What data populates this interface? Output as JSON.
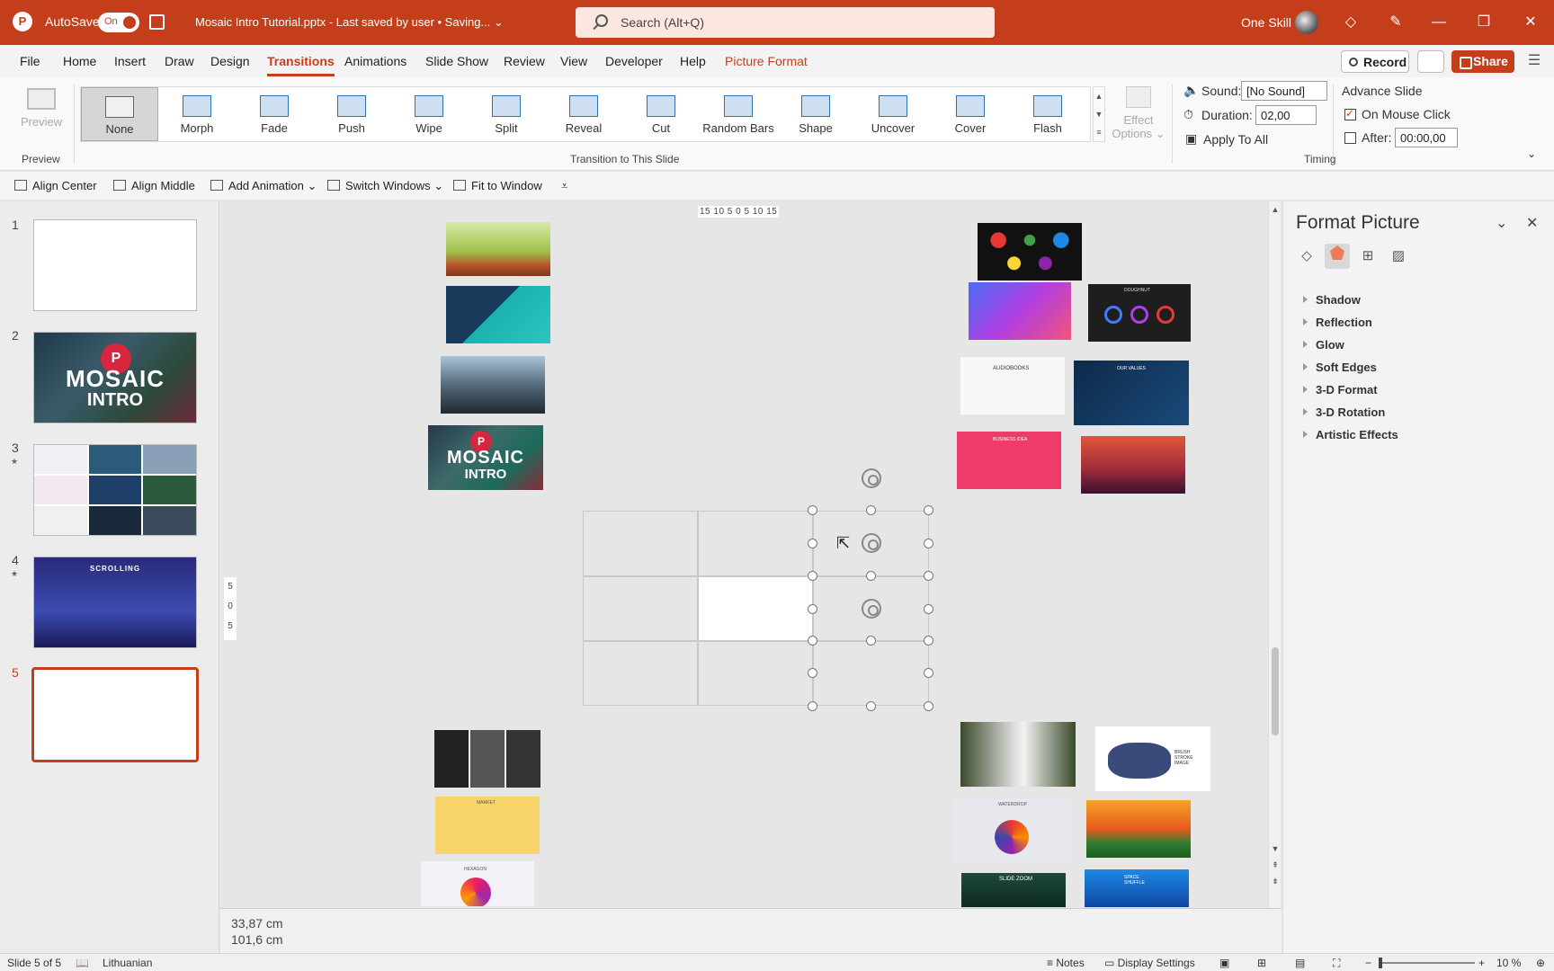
{
  "titlebar": {
    "app_logo": "P",
    "autosave_label": "AutoSave",
    "autosave_state": "On",
    "document_title": "Mosaic Intro Tutorial.pptx  -  Last saved by user • Saving... ⌄",
    "search_placeholder": "Search (Alt+Q)",
    "user_name": "One Skill",
    "accent_color": "#c43e1c"
  },
  "menu": {
    "tabs": [
      "File",
      "Home",
      "Insert",
      "Draw",
      "Design",
      "Transitions",
      "Animations",
      "Slide Show",
      "Review",
      "View",
      "Developer",
      "Help",
      "Picture Format"
    ],
    "active_tab": "Transitions",
    "record_label": "Record",
    "share_label": "Share"
  },
  "ribbon": {
    "preview_label": "Preview",
    "preview_group": "Preview",
    "transitions": [
      "None",
      "Morph",
      "Fade",
      "Push",
      "Wipe",
      "Split",
      "Reveal",
      "Cut",
      "Random Bars",
      "Shape",
      "Uncover",
      "Cover",
      "Flash"
    ],
    "selected_transition": "None",
    "effect_options_line1": "Effect",
    "effect_options_line2": "Options ⌄",
    "transition_group": "Transition to This Slide",
    "sound_label": "Sound:",
    "sound_value": "[No Sound]",
    "duration_label": "Duration:",
    "duration_value": "02,00",
    "apply_all": "Apply To All",
    "advance_slide": "Advance Slide",
    "on_mouse_click": "On Mouse Click",
    "on_mouse_click_checked": true,
    "after_label": "After:",
    "after_value": "00:00,00",
    "after_checked": false,
    "timing_group": "Timing"
  },
  "quick_access": {
    "items": [
      "Align Center",
      "Align Middle",
      "Add Animation ⌄",
      "Switch Windows ⌄",
      "Fit to Window"
    ]
  },
  "thumbnails": {
    "numbers": [
      "1",
      "2",
      "3",
      "4",
      "5"
    ],
    "active": 5,
    "starred": [
      3,
      4
    ],
    "slide2_logo": "P",
    "slide2_title": "MOSAIC",
    "slide2_subtitle": "INTRO",
    "slide4_title": "SCROLLING"
  },
  "canvas": {
    "ruler_h": "15 10 5  0  5 10 15",
    "ruler_v": [
      "5",
      "0",
      "5"
    ],
    "center_pic_logo": "P",
    "center_pic_title": "MOSAIC",
    "center_pic_subtitle": "INTRO",
    "doughnut_label": "DOUGHNUT",
    "values_label": "OUR VALUES",
    "audiobooks_label": "AUDIOBOOKS",
    "business_label": "BUSINESS IDEA",
    "brush_label": "BRUSH STROKE IMAGE",
    "market_label": "MARKET",
    "hexagon_label": "HEXAGON",
    "waterdrop_label": "WATERDROP",
    "slidezoom_label": "SLIDE ZOOM",
    "shuffle_label": "SPACE SHUFFLE",
    "dimension_width": "33,87 cm",
    "dimension_height": "101,6 cm"
  },
  "format_pane": {
    "title": "Format Picture",
    "sections": [
      "Shadow",
      "Reflection",
      "Glow",
      "Soft Edges",
      "3-D Format",
      "3-D Rotation",
      "Artistic Effects"
    ]
  },
  "statusbar": {
    "slide_info": "Slide 5 of 5",
    "language": "Lithuanian",
    "notes": "Notes",
    "display_settings": "Display Settings",
    "zoom_percent": "10 %",
    "zoom_level": 0.1
  }
}
